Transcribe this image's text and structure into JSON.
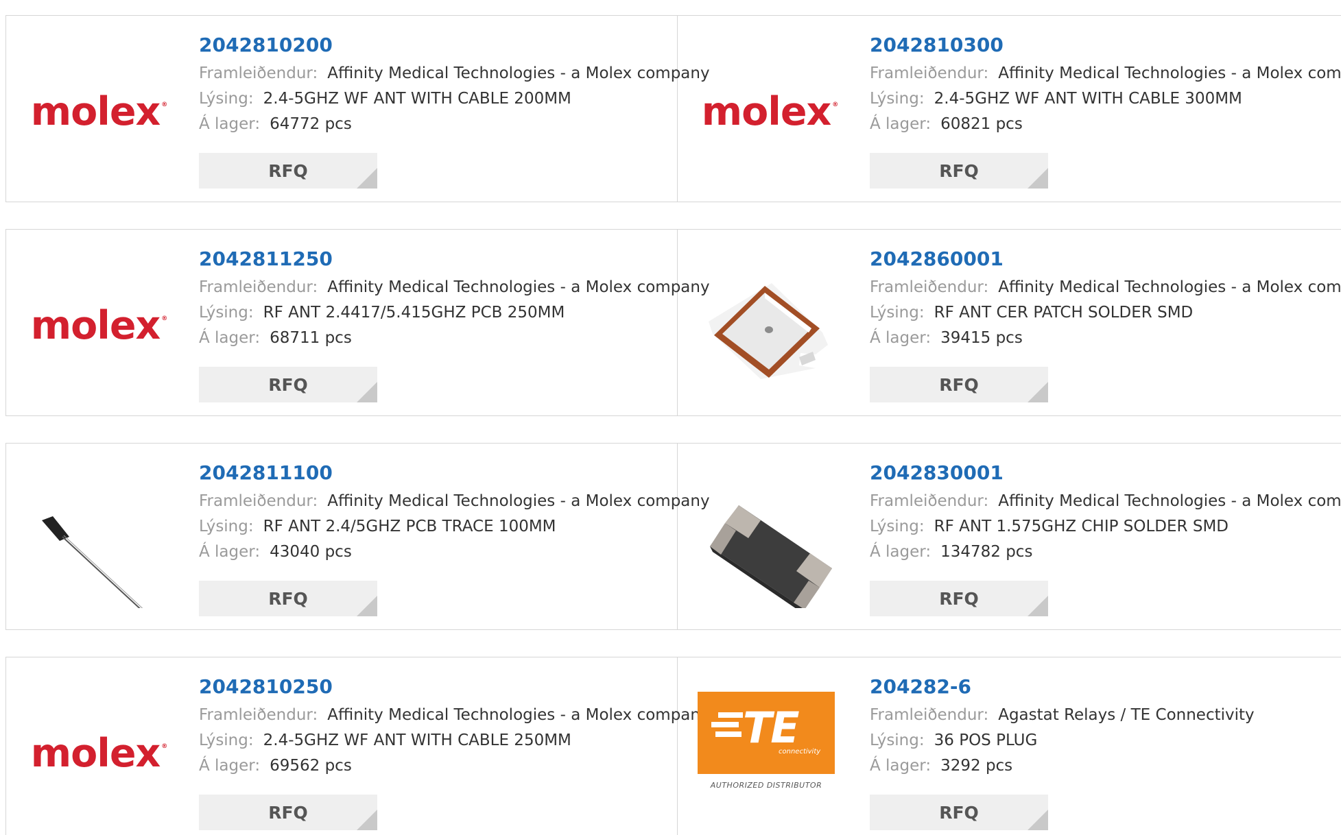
{
  "labels": {
    "manufacturer": "Framleiðendur:",
    "description": "Lýsing:",
    "stock": "Á lager:",
    "rfq": "RFQ"
  },
  "brand": {
    "molex_logo": "molex",
    "te_logo": "TE",
    "te_sub": "connectivity",
    "te_authorized": "AUTHORIZED DISTRIBUTOR"
  },
  "products": [
    {
      "part": "2042810200",
      "manufacturer": "Affinity Medical Technologies - a Molex company",
      "description": "2.4-5GHZ WF ANT WITH CABLE 200MM",
      "stock": "64772 pcs",
      "image": "molex-logo"
    },
    {
      "part": "2042810300",
      "manufacturer": "Affinity Medical Technologies - a Molex company",
      "description": "2.4-5GHZ WF ANT WITH CABLE 300MM",
      "stock": "60821 pcs",
      "image": "molex-logo"
    },
    {
      "part": "2042811250",
      "manufacturer": "Affinity Medical Technologies - a Molex company",
      "description": "RF ANT 2.4417/5.415GHZ PCB 250MM",
      "stock": "68711 pcs",
      "image": "molex-logo"
    },
    {
      "part": "2042860001",
      "manufacturer": "Affinity Medical Technologies - a Molex company",
      "description": "RF ANT CER PATCH SOLDER SMD",
      "stock": "39415 pcs",
      "image": "ceramic-patch-antenna"
    },
    {
      "part": "2042811100",
      "manufacturer": "Affinity Medical Technologies - a Molex company",
      "description": "RF ANT 2.4/5GHZ PCB TRACE 100MM",
      "stock": "43040 pcs",
      "image": "pcb-trace-antenna"
    },
    {
      "part": "2042830001",
      "manufacturer": "Affinity Medical Technologies - a Molex company",
      "description": "RF ANT 1.575GHZ CHIP SOLDER SMD",
      "stock": "134782 pcs",
      "image": "chip-antenna"
    },
    {
      "part": "2042810250",
      "manufacturer": "Affinity Medical Technologies - a Molex company",
      "description": "2.4-5GHZ WF ANT WITH CABLE 250MM",
      "stock": "69562 pcs",
      "image": "molex-logo"
    },
    {
      "part": "204282-6",
      "manufacturer": "Agastat Relays / TE Connectivity",
      "description": "36 POS PLUG",
      "stock": "3292 pcs",
      "image": "te-logo"
    }
  ]
}
